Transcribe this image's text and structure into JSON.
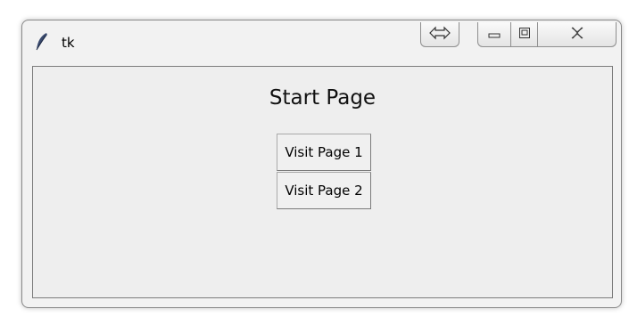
{
  "window": {
    "title": "tk",
    "icon": "feather-icon",
    "controls": {
      "resize_icon": "double-arrow-icon",
      "minimize_icon": "minimize-icon",
      "maximize_icon": "maximize-icon",
      "close_icon": "close-icon"
    }
  },
  "page": {
    "title": "Start Page",
    "buttons": [
      {
        "label": "Visit Page 1"
      },
      {
        "label": "Visit Page 2"
      }
    ]
  },
  "colors": {
    "window_background": "#eeeeee",
    "button_background": "#f0f0f0"
  }
}
